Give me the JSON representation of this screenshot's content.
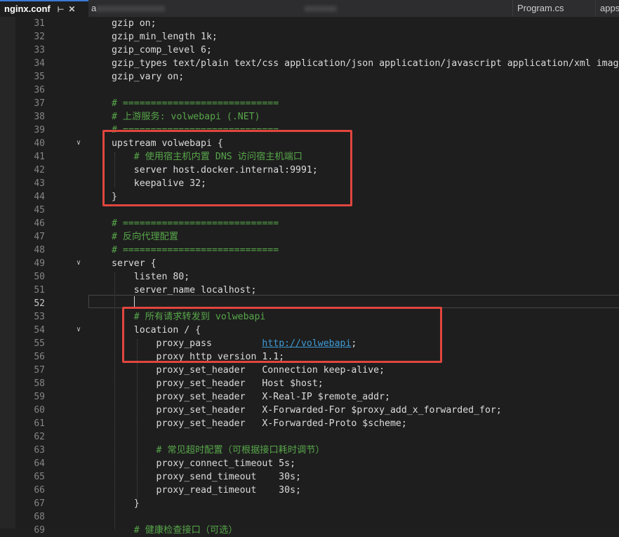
{
  "tabs": [
    {
      "label": "nginx.conf",
      "active": true
    },
    {
      "label": "a",
      "active": false
    },
    {
      "label": "Program.cs",
      "active": false
    },
    {
      "label": "apps",
      "active": false
    }
  ],
  "icons": {
    "pin": "pin-icon",
    "close": "close-icon",
    "fold": "chevron-down-icon"
  },
  "colors": {
    "comment": "#57a64a",
    "link": "#3e9bd8",
    "highlight_box": "#e0463e",
    "line_number": "#858585"
  },
  "editor": {
    "current_line": "52",
    "lines": [
      {
        "num": "31",
        "text": "gzip on;"
      },
      {
        "num": "32",
        "text": "gzip_min_length 1k;"
      },
      {
        "num": "33",
        "text": "gzip_comp_level 6;"
      },
      {
        "num": "34",
        "text": "gzip_types text/plain text/css application/json application/javascript application/xml image/"
      },
      {
        "num": "35",
        "text": "gzip_vary on;"
      },
      {
        "num": "36",
        "text": ""
      },
      {
        "num": "37",
        "text": "# ============================",
        "comment": true
      },
      {
        "num": "38",
        "text": "# 上游服务: volwebapi (.NET)",
        "comment": true
      },
      {
        "num": "39",
        "text": "# ============================",
        "comment": true
      },
      {
        "num": "40",
        "text": "upstream volwebapi {",
        "fold": true
      },
      {
        "num": "41",
        "text": "    # 使用宿主机内置 DNS 访问宿主机端口",
        "comment": true
      },
      {
        "num": "42",
        "text": "    server host.docker.internal:9991;"
      },
      {
        "num": "43",
        "text": "    keepalive 32;"
      },
      {
        "num": "44",
        "text": "}"
      },
      {
        "num": "45",
        "text": ""
      },
      {
        "num": "46",
        "text": "# ============================",
        "comment": true
      },
      {
        "num": "47",
        "text": "# 反向代理配置",
        "comment": true
      },
      {
        "num": "48",
        "text": "# ============================",
        "comment": true
      },
      {
        "num": "49",
        "text": "server {",
        "fold": true
      },
      {
        "num": "50",
        "text": "    listen 80;"
      },
      {
        "num": "51",
        "text": "    server_name localhost;"
      },
      {
        "num": "52",
        "text": ""
      },
      {
        "num": "53",
        "text": "    # 所有请求转发到 volwebapi",
        "comment": true
      },
      {
        "num": "54",
        "text": "    location / {",
        "fold": true
      },
      {
        "num": "55",
        "text": "        proxy_pass         ",
        "link": "http://volwebapi",
        "after": ";"
      },
      {
        "num": "56",
        "text": "        proxy_http_version 1.1;"
      },
      {
        "num": "57",
        "text": "        proxy_set_header   Connection keep-alive;"
      },
      {
        "num": "58",
        "text": "        proxy_set_header   Host $host;"
      },
      {
        "num": "59",
        "text": "        proxy_set_header   X-Real-IP $remote_addr;"
      },
      {
        "num": "60",
        "text": "        proxy_set_header   X-Forwarded-For $proxy_add_x_forwarded_for;"
      },
      {
        "num": "61",
        "text": "        proxy_set_header   X-Forwarded-Proto $scheme;"
      },
      {
        "num": "62",
        "text": ""
      },
      {
        "num": "63",
        "text": "        # 常见超时配置（可根据接口耗时调节）",
        "comment": true
      },
      {
        "num": "64",
        "text": "        proxy_connect_timeout 5s;"
      },
      {
        "num": "65",
        "text": "        proxy_send_timeout    30s;"
      },
      {
        "num": "66",
        "text": "        proxy_read_timeout    30s;"
      },
      {
        "num": "67",
        "text": "    }"
      },
      {
        "num": "68",
        "text": ""
      },
      {
        "num": "69",
        "text": "    # 健康检查接口（可选）",
        "comment": true
      }
    ]
  }
}
